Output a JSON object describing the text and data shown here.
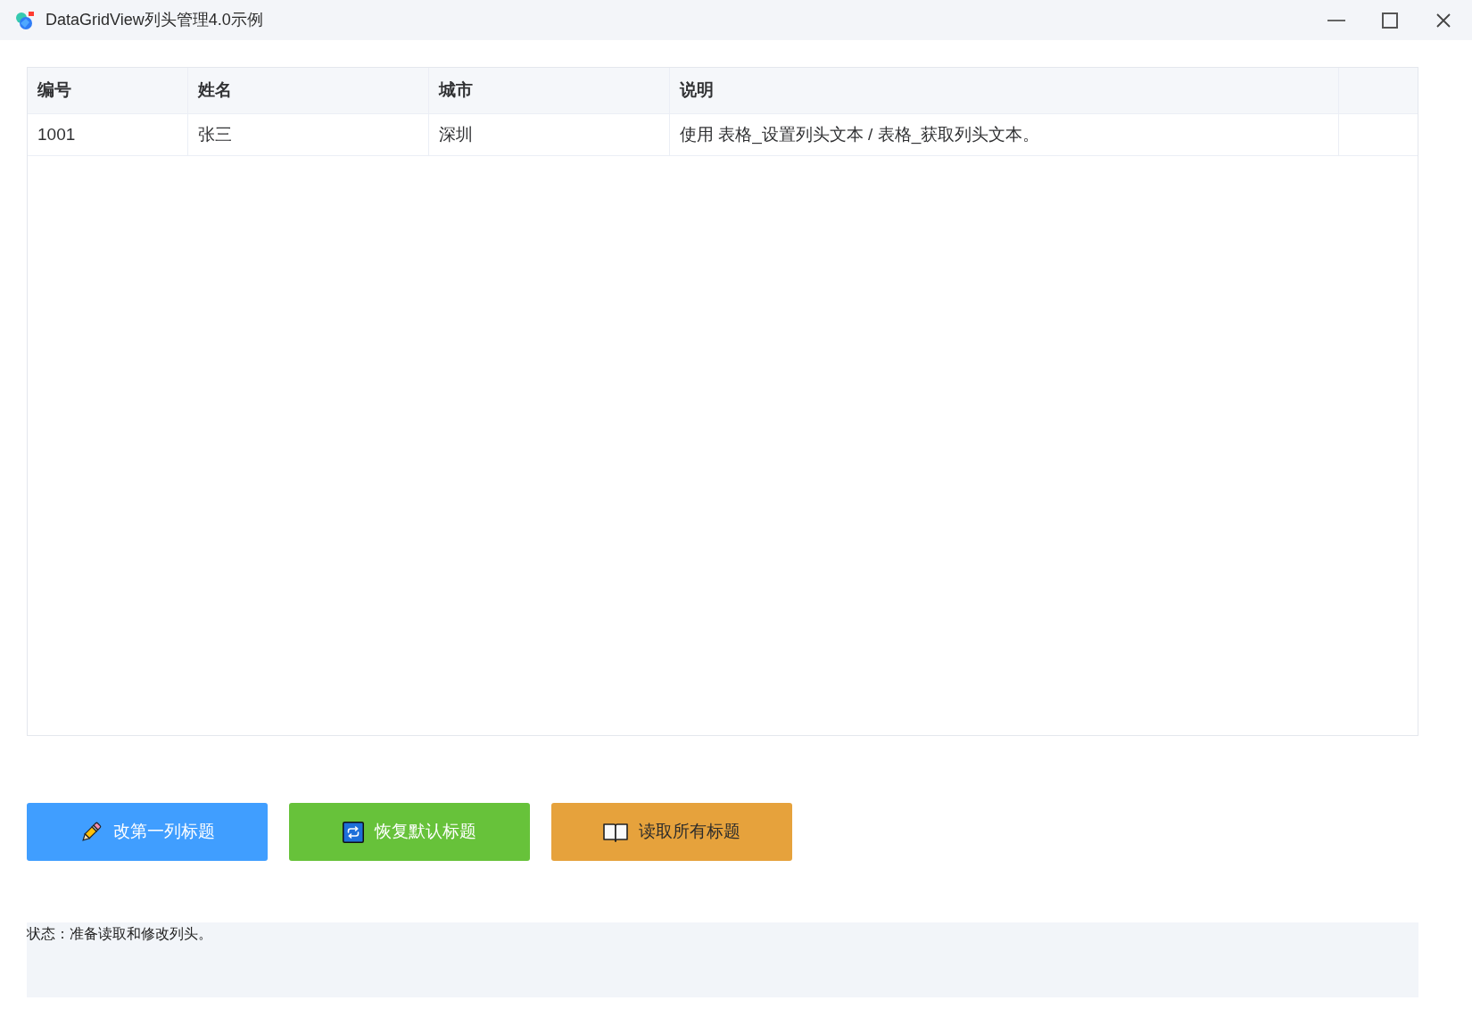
{
  "window": {
    "title": "DataGridView列头管理4.0示例"
  },
  "table": {
    "columns": [
      "编号",
      "姓名",
      "城市",
      "说明"
    ],
    "rows": [
      [
        "1001",
        "张三",
        "深圳",
        "使用 表格_设置列头文本 / 表格_获取列头文本。"
      ]
    ]
  },
  "buttons": [
    {
      "label": "改第一列标题",
      "kind": "edit",
      "color": "#409eff"
    },
    {
      "label": "恢复默认标题",
      "kind": "restore",
      "color": "#67c23a"
    },
    {
      "label": "读取所有标题",
      "kind": "read",
      "color": "#e6a23c"
    }
  ],
  "status": "状态：准备读取和修改列头。"
}
